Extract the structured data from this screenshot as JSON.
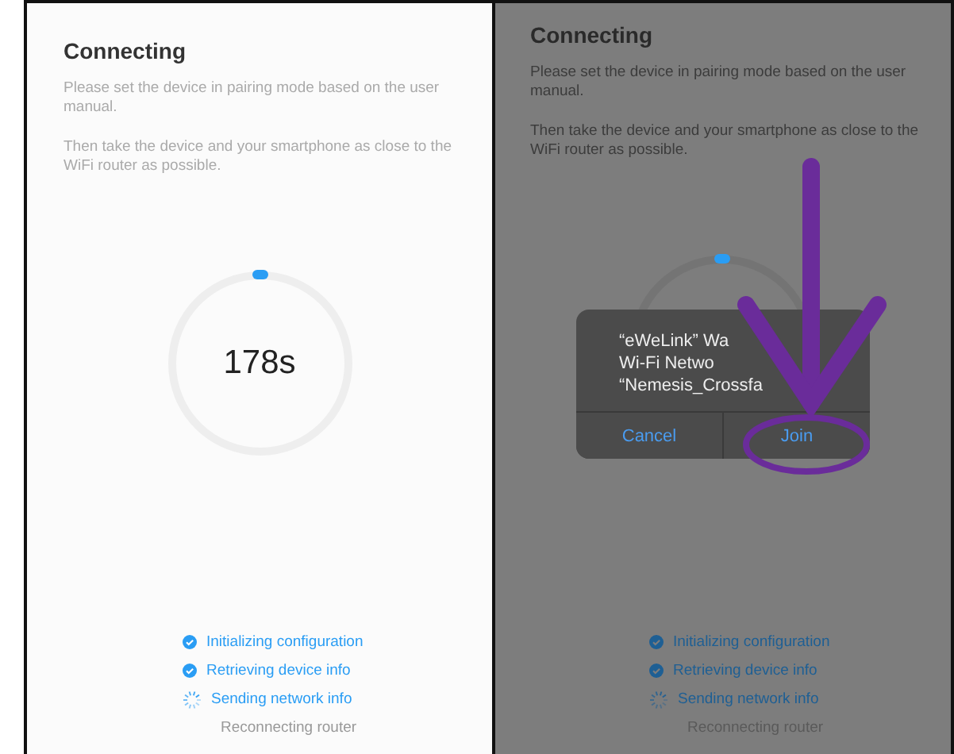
{
  "panels": [
    {
      "dimmed": false,
      "title": "Connecting",
      "paragraphs": [
        "Please set the device in pairing mode based on the user manual.",
        "Then take the device and your smartphone as close to the WiFi router as possible."
      ],
      "timer": "178s",
      "steps": [
        {
          "label": "Initializing configuration",
          "kind": "done"
        },
        {
          "label": "Retrieving device info",
          "kind": "done"
        },
        {
          "label": "Sending network info",
          "kind": "loading"
        },
        {
          "label": "Reconnecting router",
          "kind": "pending"
        }
      ]
    },
    {
      "dimmed": true,
      "title": "Connecting",
      "paragraphs": [
        "Please set the device in pairing mode based on the user manual.",
        "Then take the device and your smartphone as close to the WiFi router as possible."
      ],
      "dialog": {
        "lines": [
          "“eWeLink” Wa",
          "Wi-Fi Netwo",
          "“Nemesis_Crossfa"
        ],
        "buttons": [
          "Cancel",
          "Join"
        ]
      },
      "steps": [
        {
          "label": "Initializing configuration",
          "kind": "done"
        },
        {
          "label": "Retrieving device info",
          "kind": "done"
        },
        {
          "label": "Sending network info",
          "kind": "loading"
        },
        {
          "label": "Reconnecting router",
          "kind": "pending"
        }
      ]
    }
  ]
}
